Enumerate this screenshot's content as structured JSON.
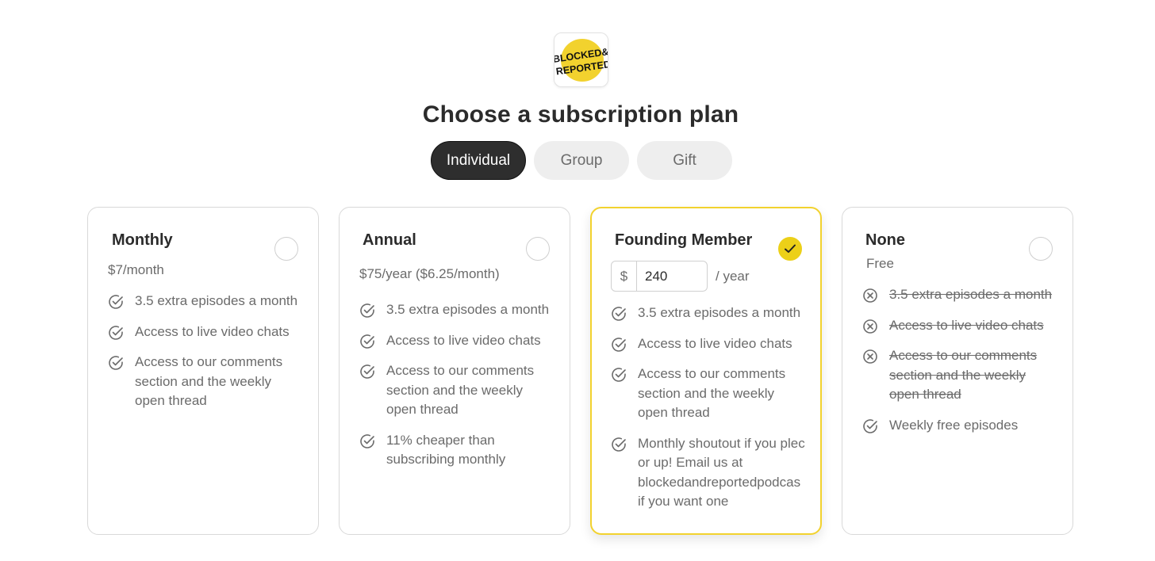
{
  "logo": {
    "line1": "BLOCKED&",
    "line2": "REPORTED",
    "accent": "#f2d22e"
  },
  "page_title": "Choose a subscription plan",
  "tabs": [
    {
      "label": "Individual",
      "active": true
    },
    {
      "label": "Group",
      "active": false
    },
    {
      "label": "Gift",
      "active": false
    }
  ],
  "colors": {
    "selected_border": "#f2d22e",
    "check_fill": "#ecd018",
    "text_muted": "#6b6b6b",
    "active_tab": "#2e2e2e"
  },
  "plans": [
    {
      "name": "Monthly",
      "price": "$7/month",
      "selected": false,
      "features": [
        {
          "lines": [
            "3.5 extra episodes a month"
          ],
          "included": true
        },
        {
          "lines": [
            "Access to live video chats"
          ],
          "included": true
        },
        {
          "lines": [
            "Access to our comments",
            "section and the weekly",
            "open thread"
          ],
          "included": true
        }
      ]
    },
    {
      "name": "Annual",
      "price": "$75/year ($6.25/month)",
      "selected": false,
      "features": [
        {
          "lines": [
            "3.5 extra episodes a month"
          ],
          "included": true
        },
        {
          "lines": [
            "Access to live video chats"
          ],
          "included": true
        },
        {
          "lines": [
            "Access to our comments",
            "section and the weekly",
            "open thread"
          ],
          "included": true
        },
        {
          "lines": [
            "11% cheaper than",
            "subscribing monthly"
          ],
          "included": true
        }
      ]
    },
    {
      "name": "Founding Member",
      "selected": true,
      "currency_symbol": "$",
      "amount": "240",
      "period": "/ year",
      "features": [
        {
          "lines": [
            "3.5 extra episodes a month"
          ],
          "included": true
        },
        {
          "lines": [
            "Access to live video chats"
          ],
          "included": true
        },
        {
          "lines": [
            "Access to our comments",
            "section and the weekly",
            "open thread"
          ],
          "included": true
        },
        {
          "lines": [
            "Monthly shoutout if you plec",
            "or up! Email us at",
            "blockedandreportedpodcas",
            "if you want one"
          ],
          "included": true
        }
      ]
    },
    {
      "name": "None",
      "price": "Free",
      "selected": false,
      "features": [
        {
          "lines": [
            "3.5 extra episodes a month"
          ],
          "included": false
        },
        {
          "lines": [
            "Access to live video chats"
          ],
          "included": false
        },
        {
          "lines": [
            "Access to our comments",
            "section and the weekly",
            "open thread"
          ],
          "included": false
        },
        {
          "lines": [
            "Weekly free episodes"
          ],
          "included": true
        }
      ]
    }
  ]
}
